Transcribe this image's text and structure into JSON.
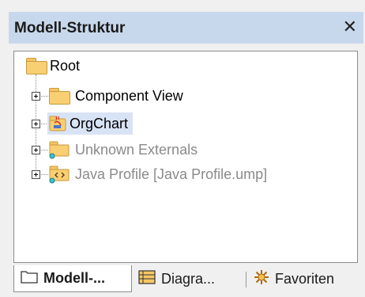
{
  "panel": {
    "title": "Modell-Struktur",
    "close_glyph": "✕"
  },
  "tree": {
    "root": {
      "label": "Root",
      "icon": "folder-icon"
    },
    "items": [
      {
        "label": "Component View",
        "icon": "folder-icon",
        "expander": "+",
        "state": "normal"
      },
      {
        "label": "OrgChart",
        "icon": "java-project-icon",
        "expander": "+",
        "state": "selected"
      },
      {
        "label": "Unknown Externals",
        "icon": "linked-folder-icon",
        "expander": "+",
        "state": "disabled"
      },
      {
        "label": "Java Profile [Java Profile.ump]",
        "icon": "java-profile-icon",
        "expander": "+",
        "state": "disabled"
      }
    ]
  },
  "tabs": [
    {
      "label": "Modell-...",
      "icon": "tree-window-icon",
      "active": true
    },
    {
      "label": "Diagra...",
      "icon": "diagram-list-icon",
      "active": false
    },
    {
      "label": "Favoriten",
      "icon": "favorites-icon",
      "active": false
    }
  ],
  "colors": {
    "titlebar": "#c8d8ec",
    "selection": "#d9e3f6",
    "disabled_text": "#8a8a8a"
  }
}
